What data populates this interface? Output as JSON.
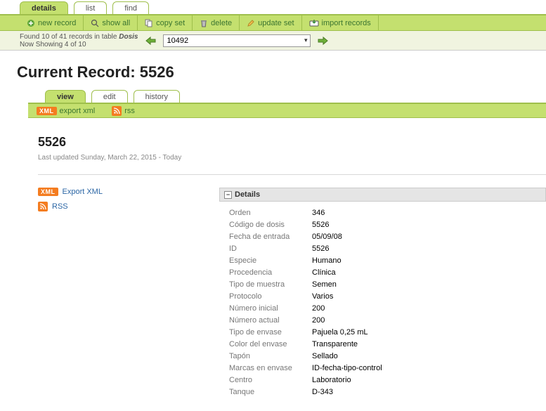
{
  "top_tabs": {
    "details": "details",
    "list": "list",
    "find": "find"
  },
  "toolbar": {
    "new_record": "new record",
    "show_all": "show all",
    "copy_set": "copy set",
    "delete": "delete",
    "update_set": "update set",
    "import_records": "import records"
  },
  "nav": {
    "found_prefix": "Found ",
    "found_mid": " of ",
    "found_suffix": " records in table ",
    "found_n": "10",
    "found_total": "41",
    "table_name": "Dosis",
    "showing_prefix": "Now Showing ",
    "showing_mid": " of ",
    "showing_n": "4",
    "showing_total": "10",
    "selected_record": "10492"
  },
  "heading": {
    "prefix": "Current Record: ",
    "id": "5526"
  },
  "view_tabs": {
    "view": "view",
    "edit": "edit",
    "history": "history"
  },
  "subtoolbar": {
    "export_xml": "export xml",
    "rss": "rss"
  },
  "record_header": {
    "title": "5526",
    "last_updated": "Last updated Sunday, March 22, 2015 - Today"
  },
  "left_links": {
    "export_xml": "Export XML",
    "rss": "RSS"
  },
  "details_panel": {
    "title": "Details",
    "rows": [
      {
        "k": "Orden",
        "v": "346"
      },
      {
        "k": "Código de dosis",
        "v": "5526"
      },
      {
        "k": "Fecha de entrada",
        "v": "05/09/08"
      },
      {
        "k": "ID",
        "v": "5526"
      },
      {
        "k": "Especie",
        "v": "Humano"
      },
      {
        "k": "Procedencia",
        "v": "Clínica"
      },
      {
        "k": "Tipo de muestra",
        "v": "Semen"
      },
      {
        "k": "Protocolo",
        "v": "Varios"
      },
      {
        "k": "Número inicial",
        "v": "200"
      },
      {
        "k": "Número actual",
        "v": "200"
      },
      {
        "k": "Tipo de envase",
        "v": "Pajuela 0,25 mL"
      },
      {
        "k": "Color del envase",
        "v": "Transparente"
      },
      {
        "k": "Tapón",
        "v": "Sellado"
      },
      {
        "k": "Marcas en envase",
        "v": "ID-fecha-tipo-control"
      },
      {
        "k": "Centro",
        "v": "Laboratorio"
      },
      {
        "k": "Tanque",
        "v": "D-343"
      }
    ]
  }
}
